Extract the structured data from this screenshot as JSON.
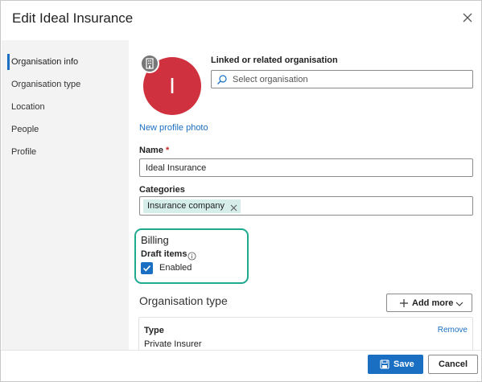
{
  "dialog": {
    "title": "Edit Ideal Insurance",
    "close_icon": "close-icon"
  },
  "sidebar": {
    "items": [
      {
        "label": "Organisation info",
        "active": true
      },
      {
        "label": "Organisation type",
        "active": false
      },
      {
        "label": "Location",
        "active": false
      },
      {
        "label": "People",
        "active": false
      },
      {
        "label": "Profile",
        "active": false
      }
    ]
  },
  "profile": {
    "avatar_initial": "I",
    "avatar_color": "#d0313f",
    "badge_icon": "building-icon",
    "new_photo_link": "New profile photo"
  },
  "linked_org": {
    "label": "Linked or related organisation",
    "placeholder": "Select organisation",
    "icon": "search-icon"
  },
  "name_field": {
    "label": "Name",
    "required_marker": "*",
    "value": "Ideal Insurance"
  },
  "categories": {
    "label": "Categories",
    "tags": [
      "Insurance company"
    ],
    "tag_color": "#d6eeea"
  },
  "billing": {
    "title": "Billing",
    "draft_items_label": "Draft items",
    "info_icon": "info-icon",
    "enabled_label": "Enabled",
    "enabled_checked": true,
    "highlight_color": "#1fa98f"
  },
  "organisation_type": {
    "title": "Organisation type",
    "add_more_label": "Add more",
    "card": {
      "type_label": "Type",
      "type_value": "Private Insurer",
      "remove_label": "Remove"
    }
  },
  "footer": {
    "save_label": "Save",
    "cancel_label": "Cancel",
    "accent_color": "#1b6fc2"
  }
}
